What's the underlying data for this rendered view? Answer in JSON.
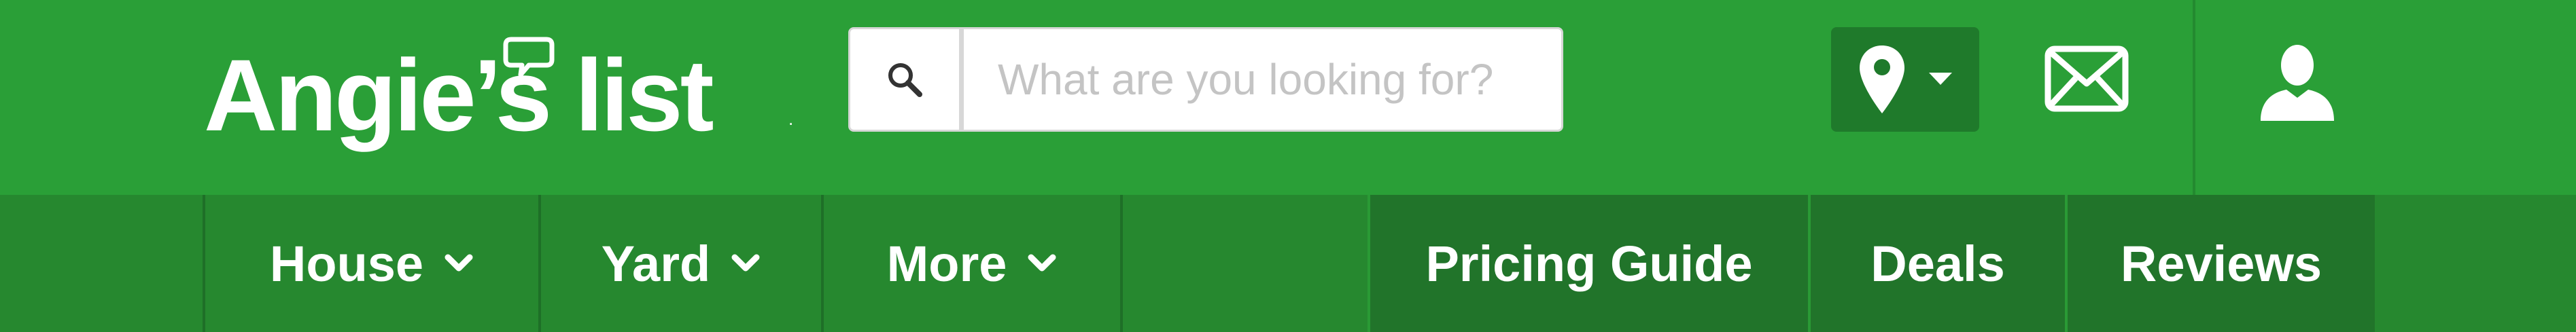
{
  "logo": {
    "text": "Angie’s list",
    "tm": "."
  },
  "search": {
    "placeholder": "What are you looking for?"
  },
  "header_icons": {
    "search": "search-icon",
    "location": "map-pin-icon",
    "location_dropdown": "caret-down-icon",
    "mail": "envelope-icon",
    "user": "user-icon"
  },
  "nav": {
    "left": [
      {
        "label": "House"
      },
      {
        "label": "Yard"
      },
      {
        "label": "More"
      }
    ],
    "right": [
      {
        "label": "Pricing Guide"
      },
      {
        "label": "Deals"
      },
      {
        "label": "Reviews"
      }
    ]
  },
  "colors": {
    "brand_green": "#2a9f37",
    "nav_green": "#26882f",
    "nav_right_green": "#21742a",
    "location_button": "#1f7a2b",
    "white": "#ffffff"
  }
}
